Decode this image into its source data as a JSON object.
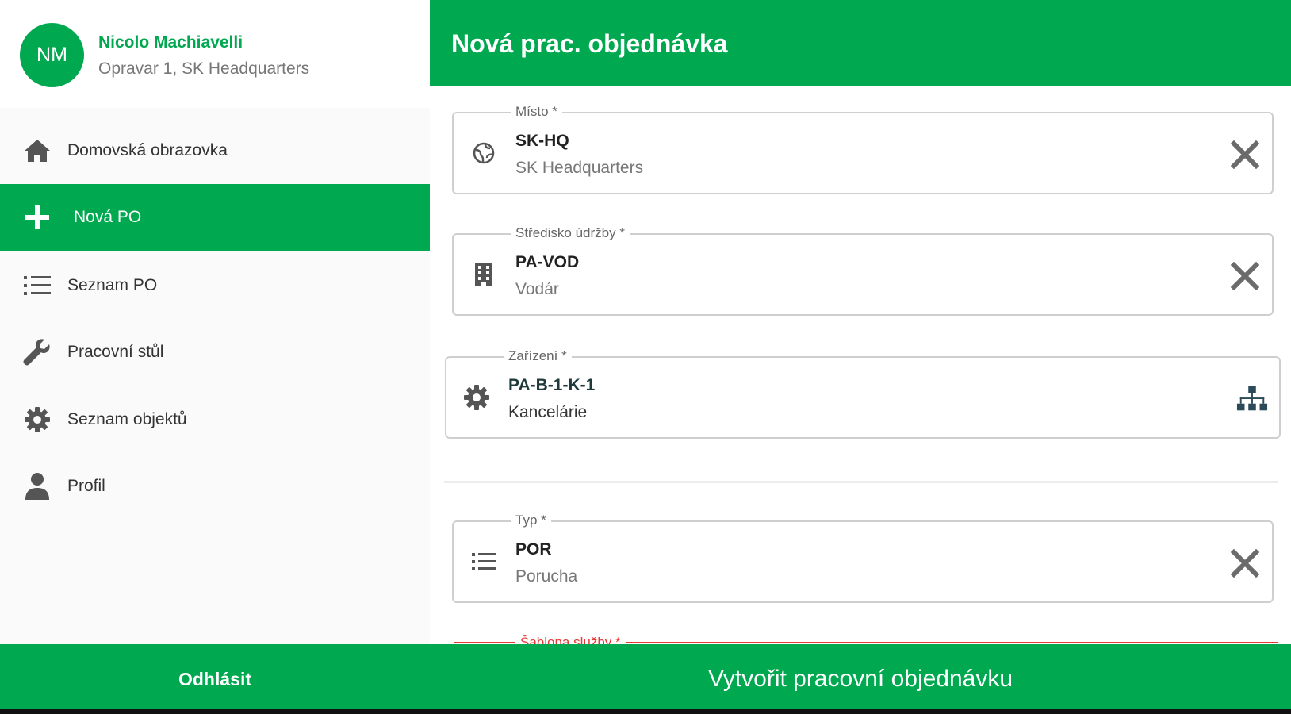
{
  "user": {
    "initials": "NM",
    "name": "Nicolo Machiavelli",
    "subtitle": "Opravar 1, SK Headquarters"
  },
  "sidebar": {
    "items": [
      {
        "label": "Domovská obrazovka",
        "icon": "home-icon"
      },
      {
        "label": "Nová PO",
        "icon": "plus-icon",
        "active": true
      },
      {
        "label": "Seznam PO",
        "icon": "list-icon"
      },
      {
        "label": "Pracovní stůl",
        "icon": "wrench-icon"
      },
      {
        "label": "Seznam objektů",
        "icon": "gear-icon"
      },
      {
        "label": "Profil",
        "icon": "person-icon"
      }
    ]
  },
  "header": {
    "title": "Nová prac. objednávka"
  },
  "form": {
    "fields": [
      {
        "legend": "Místo *",
        "code": "SK-HQ",
        "description": "SK Headquarters",
        "icon": "globe-icon",
        "action": "clear-icon"
      },
      {
        "legend": "Středisko údržby *",
        "code": "PA-VOD",
        "description": "Vodár",
        "icon": "building-icon",
        "action": "clear-icon"
      },
      {
        "legend": "Zařízení *",
        "code": "PA-B-1-K-1",
        "description": "Kancelárie",
        "icon": "gear-icon",
        "action": "hierarchy-icon"
      },
      {
        "legend": "Typ *",
        "code": "POR",
        "description": "Porucha",
        "icon": "list-icon",
        "action": "clear-icon"
      }
    ],
    "partial_legend": "Šablona služby *"
  },
  "footer": {
    "logout_label": "Odhlásit",
    "create_label": "Vytvořit pracovní objednávku"
  },
  "colors": {
    "accent": "#00a850",
    "error": "#e53935"
  }
}
